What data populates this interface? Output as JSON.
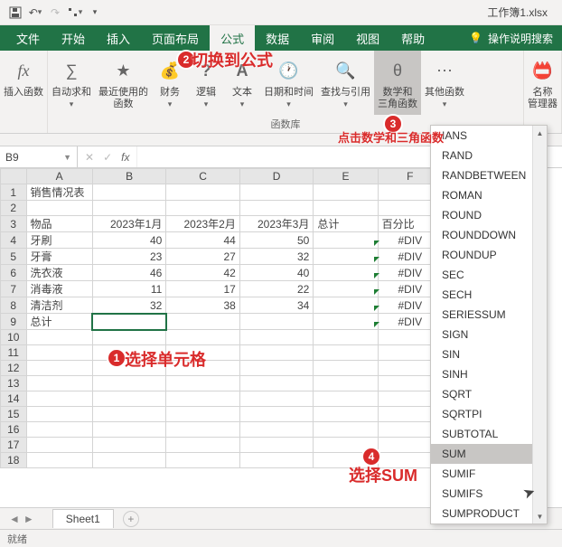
{
  "titlebar": {
    "filename": "工作簿1.xlsx"
  },
  "tabs": {
    "file": "文件",
    "home": "开始",
    "insert": "插入",
    "pagelayout": "页面布局",
    "formulas": "公式",
    "data": "数据",
    "review": "审阅",
    "view": "视图",
    "help": "帮助",
    "tellme": "操作说明搜索"
  },
  "ribbon": {
    "insert_fn": "插入函数",
    "autosum": "自动求和",
    "recent": "最近使用的\n函数",
    "financial": "财务",
    "logical": "逻辑",
    "text": "文本",
    "datetime": "日期和时间",
    "lookup": "查找与引用",
    "mathtrig": "数学和\n三角函数",
    "more": "其他函数",
    "namemgr": "名称\n管理器",
    "group_label": "函数库"
  },
  "namebox": {
    "ref": "B9"
  },
  "columns": [
    "A",
    "B",
    "C",
    "D",
    "E",
    "F"
  ],
  "chart_data": {
    "type": "table",
    "title": "销售情况表",
    "columns": [
      "物品",
      "2023年1月",
      "2023年2月",
      "2023年3月",
      "总计",
      "百分比"
    ],
    "rows": [
      {
        "item": "牙刷",
        "m1": 40,
        "m2": 44,
        "m3": 50,
        "total": "",
        "pct": "#DIV"
      },
      {
        "item": "牙膏",
        "m1": 23,
        "m2": 27,
        "m3": 32,
        "total": "",
        "pct": "#DIV"
      },
      {
        "item": "洗衣液",
        "m1": 46,
        "m2": 42,
        "m3": 40,
        "total": "",
        "pct": "#DIV"
      },
      {
        "item": "消毒液",
        "m1": 11,
        "m2": 17,
        "m3": 22,
        "total": "",
        "pct": "#DIV"
      },
      {
        "item": "清洁剂",
        "m1": 32,
        "m2": 38,
        "m3": 34,
        "total": "",
        "pct": "#DIV"
      }
    ],
    "footer_label": "总计",
    "footer_pct": "#DIV"
  },
  "headers": {
    "title": "销售情况表",
    "item": "物品",
    "m1": "2023年1月",
    "m2": "2023年2月",
    "m3": "2023年3月",
    "total": "总计",
    "pct": "百分比",
    "footer": "总计"
  },
  "cells": {
    "r4": {
      "a": "牙刷",
      "b": "40",
      "c": "44",
      "d": "50",
      "f": "#DIV"
    },
    "r5": {
      "a": "牙膏",
      "b": "23",
      "c": "27",
      "d": "32",
      "f": "#DIV"
    },
    "r6": {
      "a": "洗衣液",
      "b": "46",
      "c": "42",
      "d": "40",
      "f": "#DIV"
    },
    "r7": {
      "a": "消毒液",
      "b": "11",
      "c": "17",
      "d": "22",
      "f": "#DIV"
    },
    "r8": {
      "a": "清洁剂",
      "b": "32",
      "c": "38",
      "d": "34",
      "f": "#DIV"
    },
    "r9": {
      "f": "#DIV"
    }
  },
  "dropdown": {
    "items": [
      "IANS",
      "RAND",
      "RANDBETWEEN",
      "ROMAN",
      "ROUND",
      "ROUNDDOWN",
      "ROUNDUP",
      "SEC",
      "SECH",
      "SERIESSUM",
      "SIGN",
      "SIN",
      "SINH",
      "SQRT",
      "SQRTPI",
      "SUBTOTAL",
      "SUM",
      "SUMIF",
      "SUMIFS",
      "SUMPRODUCT"
    ]
  },
  "sheet": {
    "name": "Sheet1"
  },
  "status": {
    "ready": "就绪"
  },
  "annotations": {
    "n1": "1",
    "t1": "选择单元格",
    "n2": "2",
    "t2": "切换到公式",
    "n3": "3",
    "t3": "点击数学和三角函数",
    "n4": "4",
    "t4": "选择SUM"
  }
}
